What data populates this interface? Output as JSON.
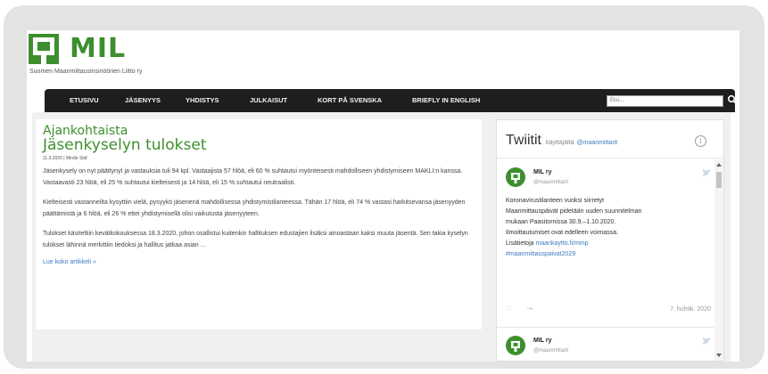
{
  "brand": {
    "logo_text": "MIL",
    "tagline": "Suomen Maanmittausinsinöörien Liitto ry",
    "color": "#3d8f2d"
  },
  "nav": {
    "items": [
      {
        "label": "ETUSIVU"
      },
      {
        "label": "JÄSENYYS"
      },
      {
        "label": "YHDISTYS"
      },
      {
        "label": "JULKAISUT"
      },
      {
        "label": "KORT PÅ SVENSKA"
      },
      {
        "label": "BRIEFLY IN ENGLISH"
      }
    ],
    "search_placeholder": "Etsi...",
    "search_icon": "search-icon"
  },
  "article": {
    "category": "Ajankohtaista",
    "title": "Jäsenkyselyn tulokset",
    "meta": "11.3.2020 | Minđe Stiđ",
    "paragraphs": [
      "Jäsenkysely on nyt päättynyt ja vastauksia tuli 94 kpl. Vastaajista 57 hlöä, eli 60 % suhtautui myönteisesti mahdolliseen yhdistymiseen MAKLI:n kanssa. Vastaavasti 23 hlöä, eli 25 % suhtautui kielteisesti ja 14 hlöä, eli 15 % suhtautui neutraalisti.",
      "Kielteisesti vastanneilta kysyttiin vielä, pysyykö jäsenenä mahdollisessa yhdistymistilanteessa. Tähän 17 hlöä, eli 74 % vastasi harkitsevansa jäsenyyden päättämistä ja 6 hlöä, eli 26 % ettei yhdistymisellä olisi vaikutusta jäsenyyteen.",
      "Tulokset käsiteltiin kevätkokouksessa 18.3.2020, johon osallistui kuitenkin hallituksen edustajien lisäksi ainoastaan kaksi muuta jäsentä. Sen takia kyselyn tulokset lähinnä merkittiin tiedoksi ja hallitus jatkaa asian ..."
    ],
    "read_more": "Lue koko artikkeli »"
  },
  "twitter": {
    "title": "Twiitit",
    "by_label": "käyttäjältä",
    "handle": "@maanmittarit",
    "info_icon": "info-icon",
    "tweets": [
      {
        "name": "MIL ry",
        "user": "@maanmittarit",
        "text_lines": [
          "Koronavirustilanteen vuoksi siirretyt",
          "Maanmittauspäivät pidetään uuden suunnitelman",
          "mukaan Paasitornissa 30.9.–1.10.2020.",
          "Ilmoittautumiset ovat edelleen voimassa."
        ],
        "more_label": "Lisätietoja",
        "link": "maankaytto.fi/mmp",
        "hashtag": "#maanmittauspaivat2029",
        "date": "7. huhtik. 2020"
      },
      {
        "name": "MIL ry",
        "user": "@maanmittarit"
      }
    ]
  }
}
